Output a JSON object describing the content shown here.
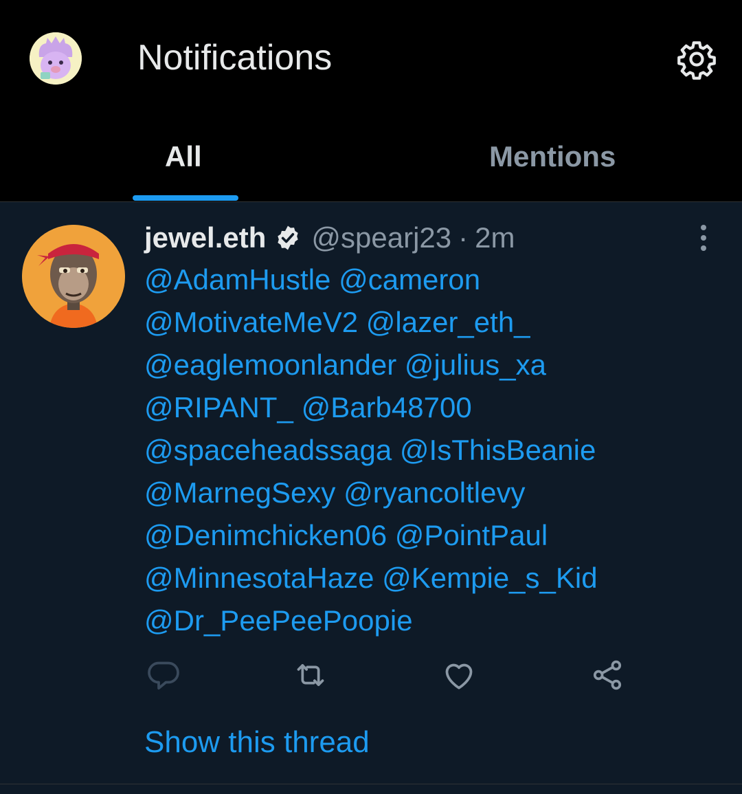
{
  "header": {
    "title": "Notifications",
    "avatar_icon": "profile-avatar-icon",
    "settings_icon": "gear-icon"
  },
  "tabs": [
    {
      "label": "All",
      "selected": true
    },
    {
      "label": "Mentions",
      "selected": false
    }
  ],
  "tweet": {
    "author_name": "jewel.eth",
    "verified_icon": "verified-badge-icon",
    "handle": "@spearj23",
    "separator": "·",
    "time": "2m",
    "more_icon": "more-vertical-icon",
    "mention_lines": [
      [
        "@AdamHustle",
        "@cameron"
      ],
      [
        "@MotivateMeV2",
        "@lazer_eth_"
      ],
      [
        "@eaglemoonlander",
        "@julius_xa"
      ],
      [
        "@RIPANT_",
        "@Barb48700"
      ],
      [
        "@spaceheadssaga",
        "@IsThisBeanie"
      ],
      [
        "@MarnegSexy",
        "@ryancoltlevy"
      ],
      [
        "@Denimchicken06",
        "@PointPaul"
      ],
      [
        "@MinnesotaHaze",
        "@Kempie_s_Kid"
      ],
      [
        "@Dr_PeePeePoopie"
      ]
    ],
    "actions": [
      "reply-icon",
      "retweet-icon",
      "like-icon",
      "share-icon"
    ],
    "show_thread": "Show this thread"
  },
  "colors": {
    "background": "#000000",
    "feed_background": "#0e1a27",
    "accent": "#1d9bf0",
    "secondary_text": "#8b98a5",
    "primary_text": "#e7e9ea"
  }
}
